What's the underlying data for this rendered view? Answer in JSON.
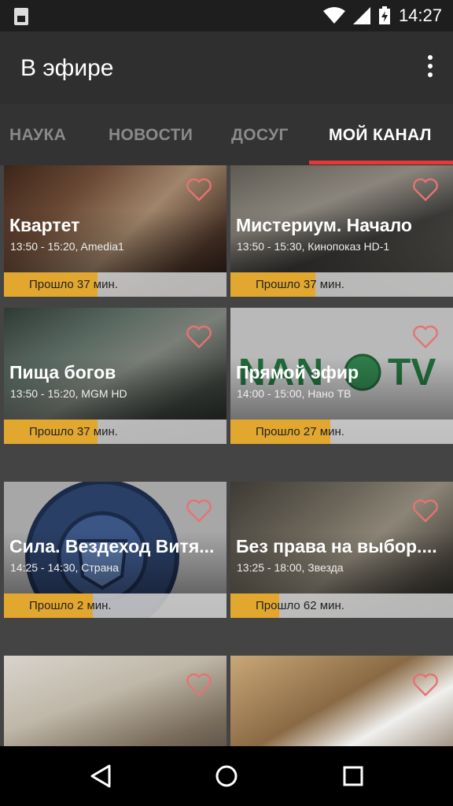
{
  "status_bar": {
    "time": "14:27"
  },
  "app_bar": {
    "title": "В эфире"
  },
  "tabs": [
    {
      "label": "НАУКА",
      "active": false
    },
    {
      "label": "НОВОСТИ",
      "active": false
    },
    {
      "label": "ДОСУГ",
      "active": false
    },
    {
      "label": "МОЙ КАНАЛ",
      "active": true
    }
  ],
  "colors": {
    "accent": "#e53935",
    "progress": "#e2a72e"
  },
  "cards": [
    {
      "title": "Квартет",
      "time": "13:50 - 15:20, Amedia1",
      "progress_label": "Прошло 37 мин.",
      "progress": 0.42
    },
    {
      "title": "Мистериум. Начало",
      "time": "13:50 - 15:30, Кинопоказ HD-1",
      "progress_label": "Прошло 37 мин.",
      "progress": 0.38
    },
    {
      "title": "Пища богов",
      "time": "13:50 - 15:20, MGM HD",
      "progress_label": "Прошло 37 мин.",
      "progress": 0.42
    },
    {
      "title": "Прямой эфир",
      "time": "14:00 - 15:00, Нано ТВ",
      "progress_label": "Прошло 27 мин.",
      "progress": 0.45
    },
    {
      "title": "Сила. Вездеход Витя...",
      "time": "14:25 - 14:30, Страна",
      "progress_label": "Прошло 2 мин.",
      "progress": 0.4
    },
    {
      "title": "Без права на выбор....",
      "time": "13:25 - 18:00, Звезда",
      "progress_label": "Прошло 62 мин.",
      "progress": 0.22
    }
  ]
}
